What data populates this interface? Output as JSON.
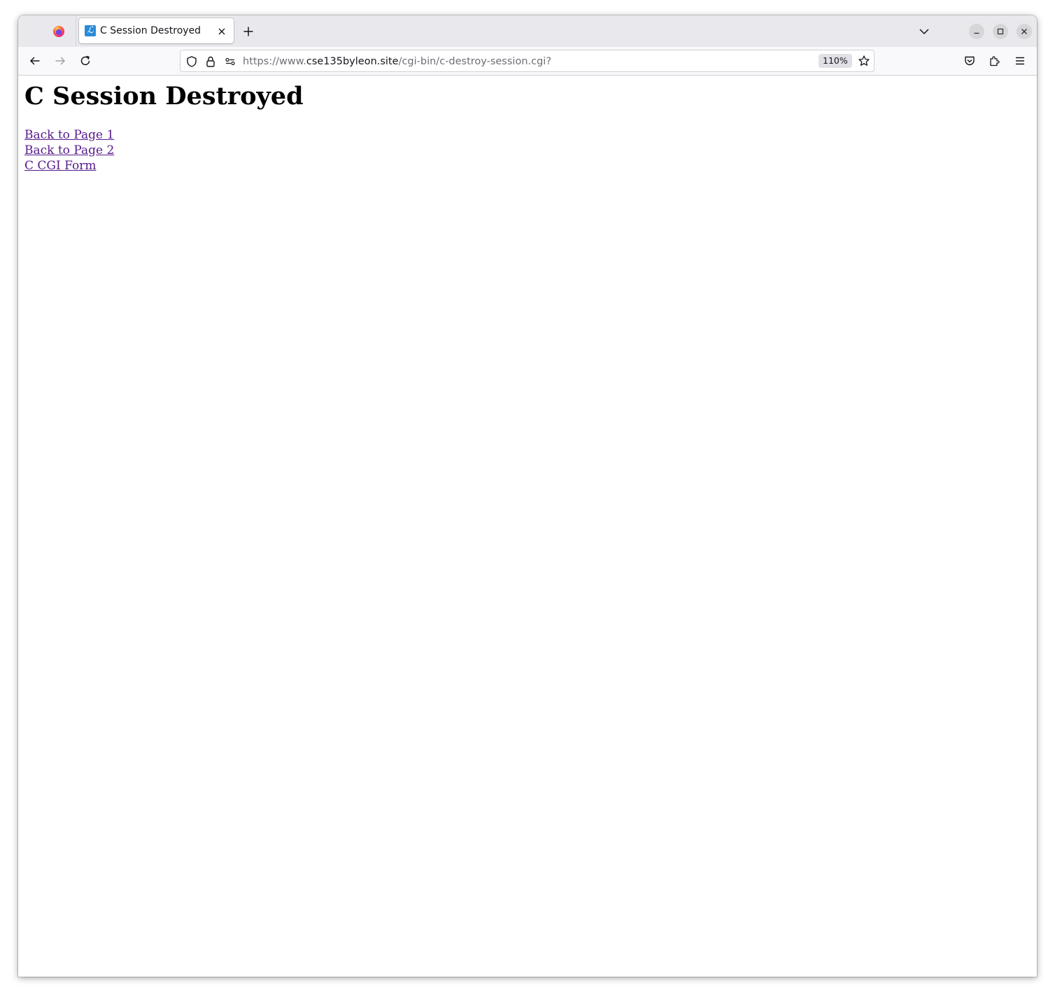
{
  "browser": {
    "tab": {
      "title": "C Session Destroyed",
      "favicon_glyph": "ℒ",
      "favicon_color": "#2a8bd8"
    },
    "url": {
      "prefix": "https://www.",
      "host": "cse135byleon.site",
      "path": "/cgi-bin/c-destroy-session.cgi?"
    },
    "zoom": "110%",
    "icons": {
      "firefox": "firefox-logo-icon",
      "tab_close": "close-icon",
      "new_tab": "plus-icon",
      "list_tabs": "chevron-down-icon",
      "minimize": "minimize-icon",
      "maximize": "maximize-icon",
      "close_window": "close-icon",
      "back": "arrow-left-icon",
      "forward": "arrow-right-icon",
      "reload": "reload-icon",
      "tracking_protection": "shield-icon",
      "connection": "lock-icon",
      "permissions": "permissions-icon",
      "bookmark": "star-icon",
      "pocket": "pocket-icon",
      "extensions": "puzzle-icon",
      "menu": "hamburger-menu-icon"
    }
  },
  "page": {
    "heading": "C Session Destroyed",
    "links": [
      {
        "label": "Back to Page 1"
      },
      {
        "label": "Back to Page 2"
      },
      {
        "label": "C CGI Form"
      }
    ],
    "link_color": "#551a8b"
  }
}
